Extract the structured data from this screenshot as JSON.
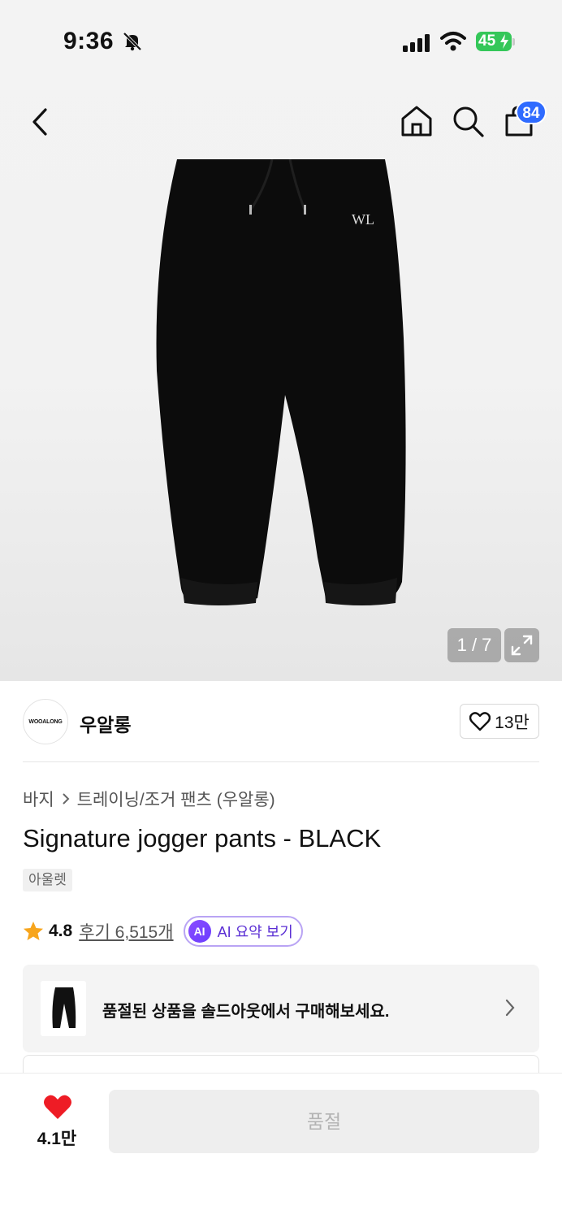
{
  "status_bar": {
    "time": "9:36",
    "battery": "45"
  },
  "header": {
    "cart_count": "84"
  },
  "gallery": {
    "pager": "1 / 7",
    "logo_mark": "WL"
  },
  "brand": {
    "logo_text": "WOOALONG",
    "name": "우알롱",
    "favorites": "13만"
  },
  "breadcrumb": {
    "category": "바지",
    "subcategory": "트레이닝/조거 팬츠 (우알롱)"
  },
  "product": {
    "title": "Signature jogger pants - BLACK",
    "tag": "아울렛",
    "rating": "4.8",
    "reviews": "후기 6,515개",
    "ai_badge": "AI",
    "ai_summary": "AI 요약 보기"
  },
  "soldout_banner": {
    "text": "품절된 상품을 솔드아웃에서 구매해보세요."
  },
  "bottom_bar": {
    "likes": "4.1만",
    "buy_label": "품절"
  },
  "colors": {
    "accent_blue": "#2f6bff",
    "heart_red": "#ee1c25",
    "ai_purple": "#6a3cff",
    "star": "#f7a51c",
    "battery_green": "#34c759"
  }
}
